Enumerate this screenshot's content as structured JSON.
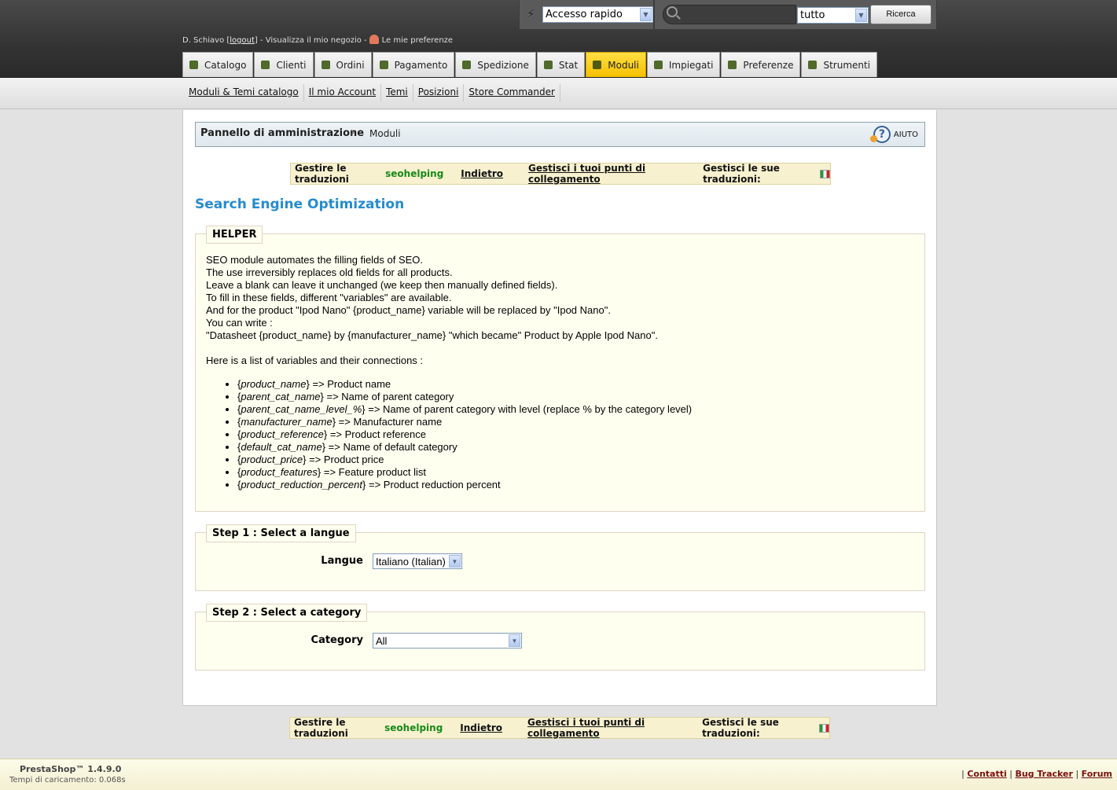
{
  "header": {
    "quick_access": {
      "selected": "Accesso rapido"
    },
    "search": {
      "placeholder": "",
      "scope_selected": "tutto",
      "button_label": "Ricerca"
    },
    "user": {
      "name": "D. Schiavo [",
      "logout": "logout",
      "middle": "] - Visualizza il mio negozio -",
      "preferences": "Le mie preferenze"
    },
    "tabs": [
      {
        "label": "Catalogo"
      },
      {
        "label": "Clienti"
      },
      {
        "label": "Ordini"
      },
      {
        "label": "Pagamento"
      },
      {
        "label": "Spedizione"
      },
      {
        "label": "Stat"
      },
      {
        "label": "Moduli",
        "active": true
      },
      {
        "label": "Impiegati"
      },
      {
        "label": "Preferenze"
      },
      {
        "label": "Strumenti"
      }
    ]
  },
  "subnav": [
    {
      "label": "Moduli & Temi catalogo"
    },
    {
      "label": "Il mio Account"
    },
    {
      "label": "Temi"
    },
    {
      "label": "Posizioni"
    },
    {
      "label": "Store Commander"
    }
  ],
  "breadcrumb": {
    "home": "Pannello di amministrazione",
    "separator": "›",
    "current": "Moduli",
    "help_label": "AIUTO"
  },
  "translation_bar": {
    "manage_prefix": "Gestire le traduzioni",
    "module_name": "seohelping",
    "back": "Indietro",
    "hooks": "Gestisci i tuoi punti di collegamento",
    "own_translations": "Gestisci le sue traduzioni:"
  },
  "page_title": "Search Engine Optimization",
  "helper": {
    "legend": "HELPER",
    "lines": [
      "SEO module automates the filling fields of SEO.",
      "The use irreversibly replaces old fields for all products.",
      "Leave a blank can leave it unchanged (we keep then manually defined fields).",
      "To fill in these fields, different \"variables\" are available.",
      "And for the product \"Ipod Nano\" {product_name} variable will be replaced by \"Ipod Nano\".",
      "You can write :",
      "\"Datasheet {product_name} by {manufacturer_name} \"which became\" Product by Apple Ipod Nano\"."
    ],
    "list_intro": "Here is a list of variables and their connections :",
    "variables": [
      {
        "name": "product_name",
        "desc": "=> Product name"
      },
      {
        "name": "parent_cat_name",
        "desc": "=> Name of parent category"
      },
      {
        "name": "parent_cat_name_level_%",
        "desc": "=> Name of parent category with level (replace % by the category level)"
      },
      {
        "name": "manufacturer_name",
        "desc": "=> Manufacturer name"
      },
      {
        "name": "product_reference",
        "desc": "=> Product reference"
      },
      {
        "name": "default_cat_name",
        "desc": "=> Name of default category"
      },
      {
        "name": "product_price",
        "desc": "=> Product price"
      },
      {
        "name": "product_features",
        "desc": "=> Feature product list"
      },
      {
        "name": "product_reduction_percent",
        "desc": "=> Product reduction percent"
      }
    ]
  },
  "step1": {
    "legend": "Step 1 : Select a langue",
    "label": "Langue",
    "selected": "Italiano (Italian)"
  },
  "step2": {
    "legend": "Step 2 : Select a category",
    "label": "Category",
    "selected": "All"
  },
  "footer": {
    "version": "PrestaShop™ 1.4.9.0",
    "load_time": "Tempi di caricamento: 0.068s",
    "links": [
      {
        "label": "Contatti"
      },
      {
        "label": "Bug Tracker"
      },
      {
        "label": "Forum"
      }
    ]
  },
  "colors": {
    "accent_title": "#268ccd",
    "module_green": "#178a19",
    "active_tab": "#ffd21c",
    "helper_bg": "#fffff0"
  },
  "icons": [
    "bolt-icon",
    "search-icon",
    "preferences-icon",
    "help-icon",
    "italian-flag-icon"
  ]
}
